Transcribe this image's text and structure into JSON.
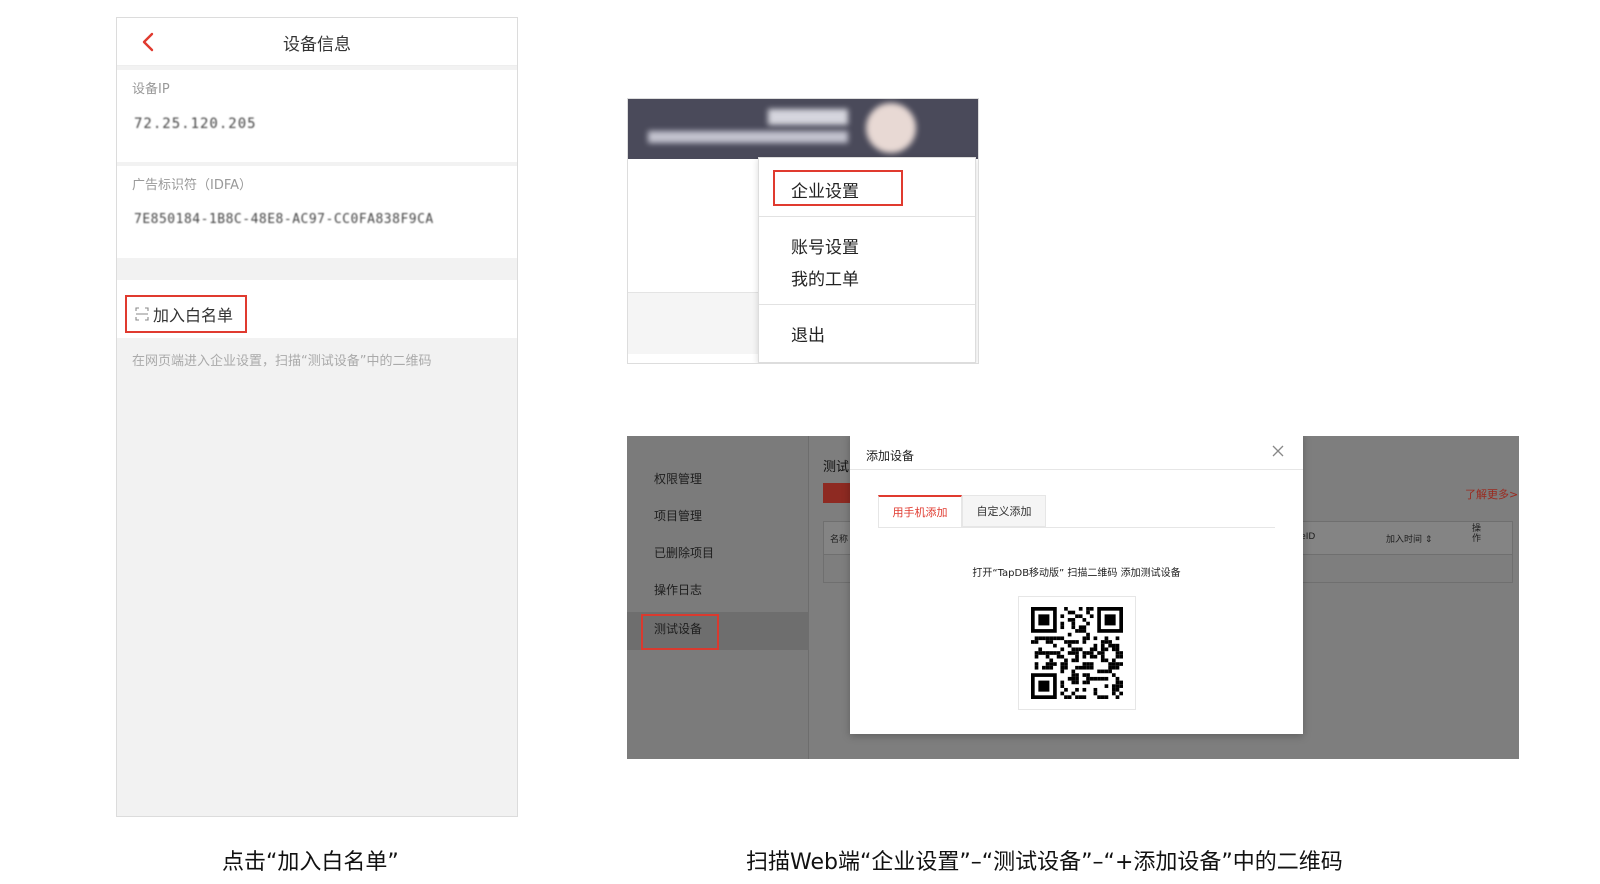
{
  "phone": {
    "nav_title": "设备信息",
    "ip_label": "设备IP",
    "ip_value": "72.25.120.205",
    "idfa_label": "广告标识符（IDFA）",
    "idfa_value": "7E850184-1B8C-48E8-AC97-CC0FA838F9CA",
    "whitelist_button": "加入白名单",
    "hint": "在网页端进入企业设置，扫描“测试设备”中的二维码"
  },
  "dropdown": {
    "items": [
      "企业设置",
      "账号设置",
      "我的工单",
      "退出"
    ]
  },
  "web": {
    "sidebar": [
      "权限管理",
      "项目管理",
      "已删除项目",
      "操作日志",
      "测试设备"
    ],
    "content_title": "测试",
    "more_link": "了解更多>",
    "columns": [
      "名称",
      "gleID",
      "加入时间 ⇕",
      "操作"
    ],
    "modal": {
      "title": "添加设备",
      "tabs": [
        "用手机添加",
        "自定义添加"
      ],
      "instruction": "打开“TapDB移动版” 扫描二维码 添加测试设备"
    }
  },
  "captions": {
    "left": "点击“加入白名单”",
    "right": "扫描Web端“企业设置”–“测试设备”–“+添加设备”中的二维码"
  },
  "colors": {
    "accent": "#e03a2f",
    "header_dark": "#4a4a5a",
    "overlay_gray": "#7e7e7e"
  }
}
